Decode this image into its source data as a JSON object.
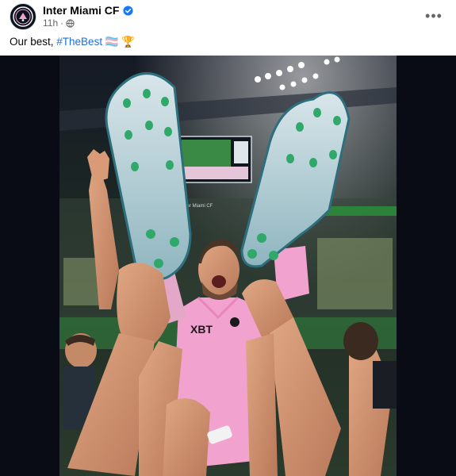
{
  "post": {
    "page_name": "Inter Miami CF",
    "timestamp": "11h",
    "timestamp_separator": "·",
    "audience_icon": "globe-icon",
    "verified_icon": "verified-badge-icon",
    "more_icon": "more-options-icon",
    "more_label": "•••",
    "caption_text": "Our best, ",
    "caption_hashtag": "#TheBest",
    "caption_emoji_1": "🏳️‍⚧️",
    "caption_emoji_2": "🏆",
    "brand_color": "#1877f2",
    "hashtag_color": "#216fdb"
  },
  "photo": {
    "scoreboard_text": "Inter Miami CF",
    "shirt_text": "XBT",
    "crest_icon": "inter-miami-crest-icon"
  }
}
